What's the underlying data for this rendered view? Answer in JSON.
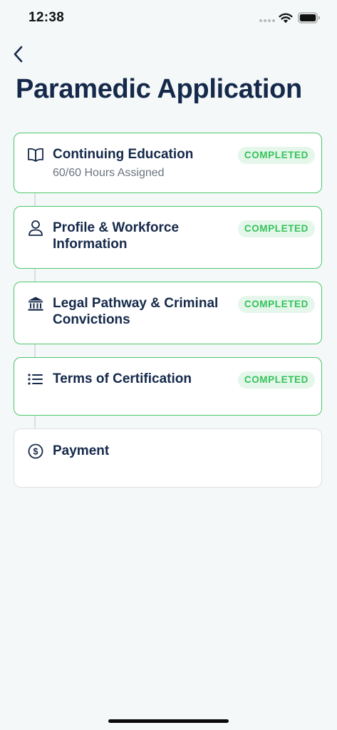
{
  "status_bar": {
    "time": "12:38"
  },
  "header": {
    "back_icon": "chevron-left-icon",
    "title": "Paramedic Application"
  },
  "colors": {
    "background": "#f5f8f9",
    "title_text": "#15294a",
    "completed_border": "#4cc86a",
    "completed_badge_text": "#34c35a",
    "completed_badge_bg": "#e5f6ea",
    "pending_border": "#dde1e5",
    "subtitle_text": "#6c7480"
  },
  "steps": [
    {
      "icon": "book-icon",
      "title": "Continuing Education",
      "subtitle": "60/60 Hours Assigned",
      "status": "COMPLETED"
    },
    {
      "icon": "person-icon",
      "title": "Profile & Workforce Information",
      "status": "COMPLETED"
    },
    {
      "icon": "bank-icon",
      "title": "Legal Pathway & Criminal Convictions",
      "status": "COMPLETED"
    },
    {
      "icon": "list-icon",
      "title": "Terms of Certification",
      "status": "COMPLETED"
    },
    {
      "icon": "dollar-circle-icon",
      "title": "Payment"
    }
  ]
}
